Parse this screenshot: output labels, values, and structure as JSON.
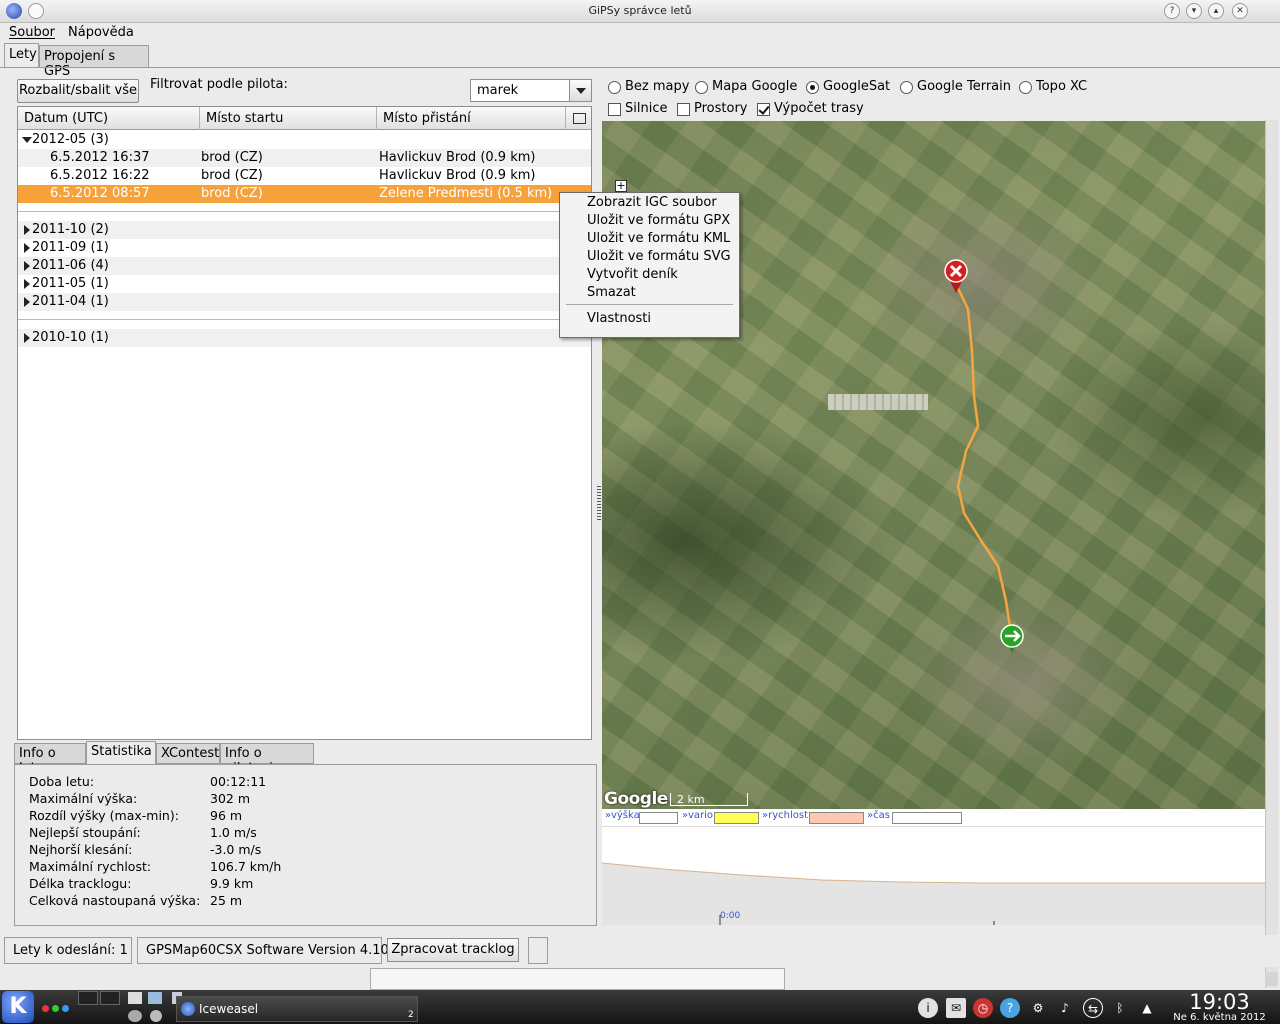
{
  "window": {
    "title": "GiPSy správce letů"
  },
  "menubar": {
    "items": [
      "Soubor",
      "Nápověda"
    ]
  },
  "top_tabs": [
    "Lety",
    "Propojení s GPS"
  ],
  "toolbar": {
    "expand_label": "Rozbalit/sbalit vše",
    "filter_label": "Filtrovat podle pilota:",
    "pilot_value": "marek"
  },
  "tree": {
    "columns": [
      "Datum (UTC)",
      "Místo startu",
      "Místo přistání"
    ],
    "groups": [
      {
        "label": "2012-05 (3)",
        "expanded": true,
        "rows": [
          {
            "date": "6.5.2012 16:37",
            "start": "brod (CZ)",
            "landing": "Havlickuv Brod (0.9 km)"
          },
          {
            "date": "6.5.2012 16:22",
            "start": "brod (CZ)",
            "landing": "Havlickuv Brod (0.9 km)"
          },
          {
            "date": "6.5.2012 08:57",
            "start": "brod (CZ)",
            "landing": "Zelene Predmesti (0.5 km)",
            "selected": true
          }
        ]
      },
      {
        "label": "2011-10 (2)"
      },
      {
        "label": "2011-09 (1)"
      },
      {
        "label": "2011-06 (4)"
      },
      {
        "label": "2011-05 (1)"
      },
      {
        "label": "2011-04 (1)"
      },
      {
        "label": "2010-10 (1)"
      }
    ]
  },
  "context_menu": {
    "items": [
      "Zobrazit IGC soubor",
      "Uložit ve formátu GPX",
      "Uložit ve formátu KML",
      "Uložit ve formátu SVG",
      "Vytvořit deník",
      "Smazat"
    ],
    "last": "Vlastnosti"
  },
  "bottom_tabs": [
    "Info o letu",
    "Statistika",
    "XContest",
    "Info o pilotovi"
  ],
  "stats": [
    {
      "label": "Doba letu:",
      "value": "00:12:11"
    },
    {
      "label": "Maximální výška:",
      "value": "302 m"
    },
    {
      "label": "Rozdíl výšky (max-min):",
      "value": "96 m"
    },
    {
      "label": "Nejlepší stoupání:",
      "value": "1.0 m/s"
    },
    {
      "label": "Nejhorší klesání:",
      "value": "-3.0 m/s"
    },
    {
      "label": "Maximální rychlost:",
      "value": "106.7 km/h"
    },
    {
      "label": "Délka tracklogu:",
      "value": "9.9 km"
    },
    {
      "label": "Celková nastoupaná výška:",
      "value": "25 m"
    }
  ],
  "map_options": {
    "radios": [
      "Bez mapy",
      "Mapa Google",
      "GoogleSat",
      "Google Terrain",
      "Topo XC"
    ],
    "selected_radio": "GoogleSat",
    "checks": [
      "Silnice",
      "Prostory",
      "Výpočet trasy"
    ],
    "checked": [
      "Výpočet trasy"
    ]
  },
  "map": {
    "logo": "Google",
    "scale_label": "2 km",
    "zoom_plus": "+"
  },
  "chart_legend": {
    "altitude": "»výška",
    "vario": "»vario",
    "speed": "»rychlost",
    "time": "»čas",
    "tick": "0:00"
  },
  "colors": {
    "vario": "#ffff55",
    "speed": "#fcc8b0",
    "track": "#f4a640",
    "selection": "#f7a13a"
  },
  "statusbar": {
    "pending": "Lety k odeslání: 1",
    "gps": "GPSMap60CSX Software Version 4.10",
    "process_label": "Zpracovat tracklog"
  },
  "taskbar": {
    "k_menu": "K",
    "task_label": "Iceweasel",
    "task_count": "2",
    "time": "19:03",
    "date": "Ne 6. května 2012"
  }
}
